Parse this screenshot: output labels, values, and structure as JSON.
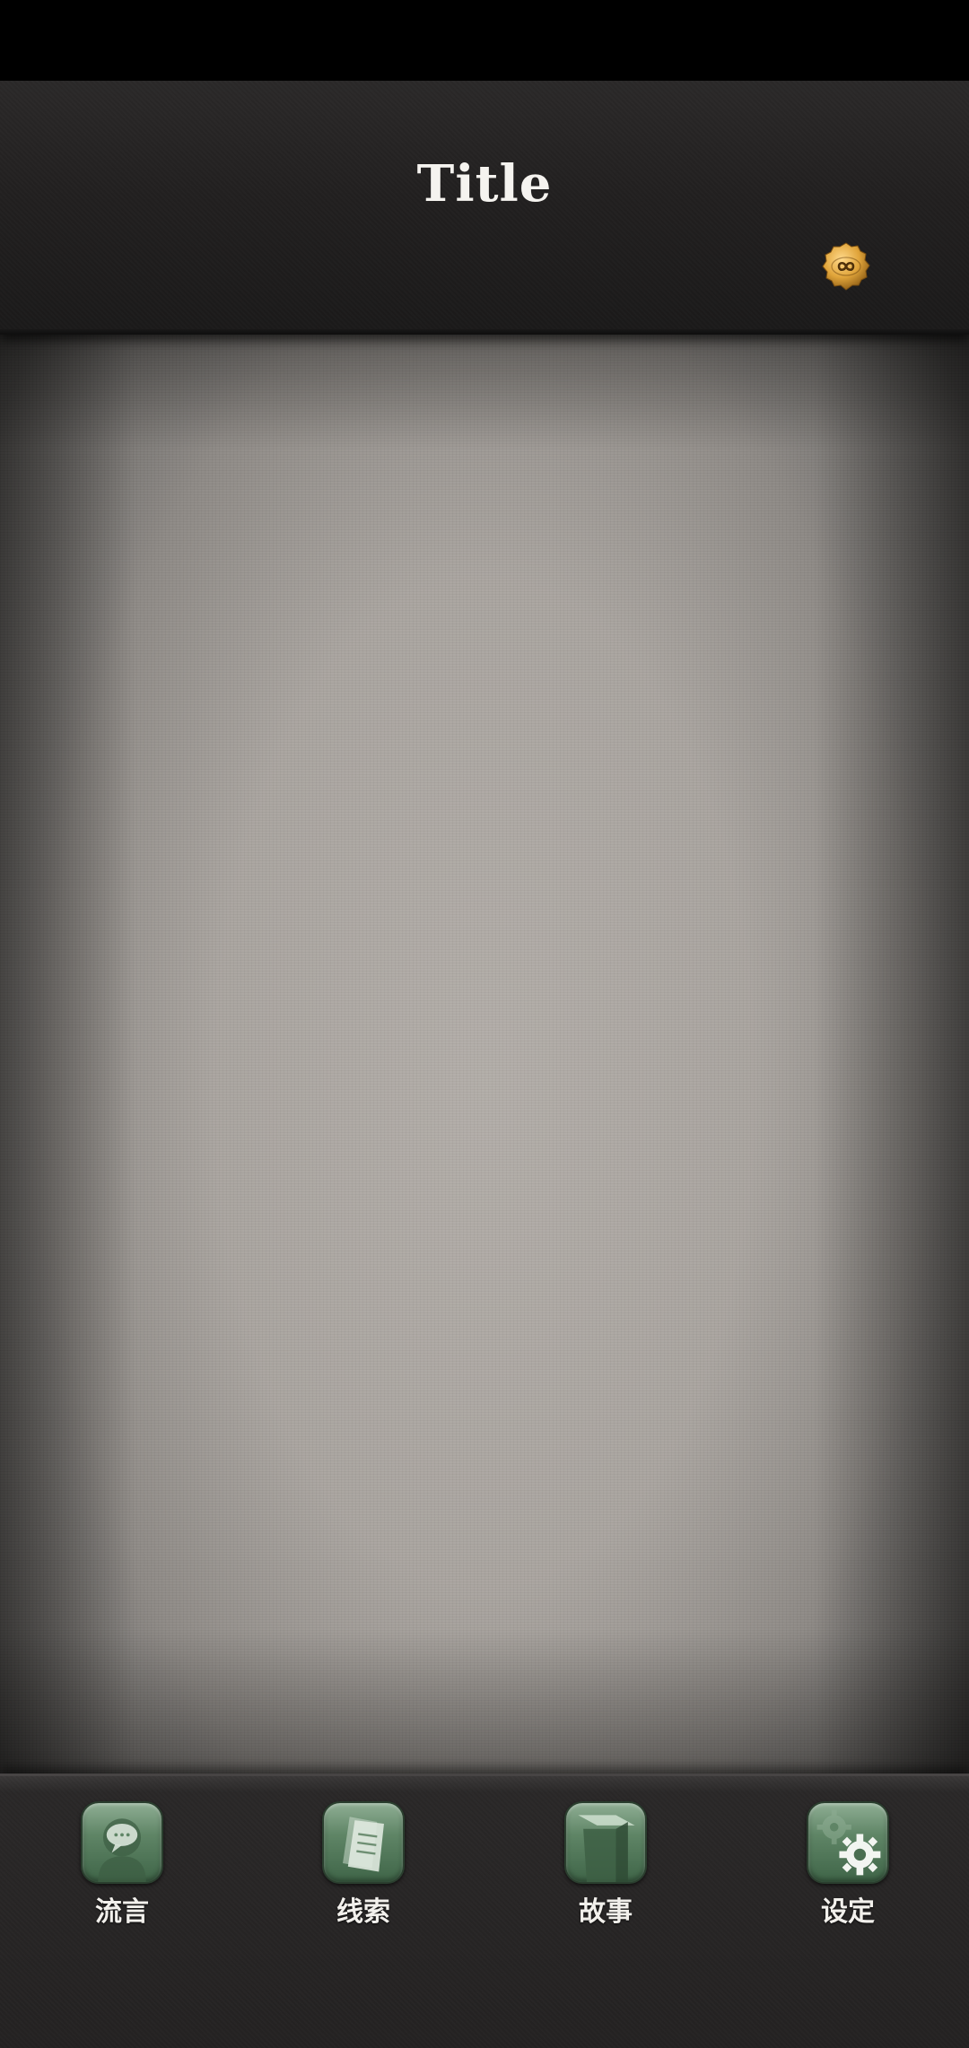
{
  "header": {
    "title": "Title",
    "badge_icon": "infinity-coin-icon"
  },
  "tabs": [
    {
      "label": "流言",
      "icon": "speech-bubble-icon"
    },
    {
      "label": "线索",
      "icon": "documents-icon"
    },
    {
      "label": "故事",
      "icon": "book-icon"
    },
    {
      "label": "设定",
      "icon": "gears-icon"
    }
  ],
  "colors": {
    "header_bg": "#222020",
    "tab_bar_bg": "#242222",
    "tab_icon_green": "#5f8566",
    "badge_gold": "#e0a43a",
    "content_bg": "#a8a39e"
  }
}
